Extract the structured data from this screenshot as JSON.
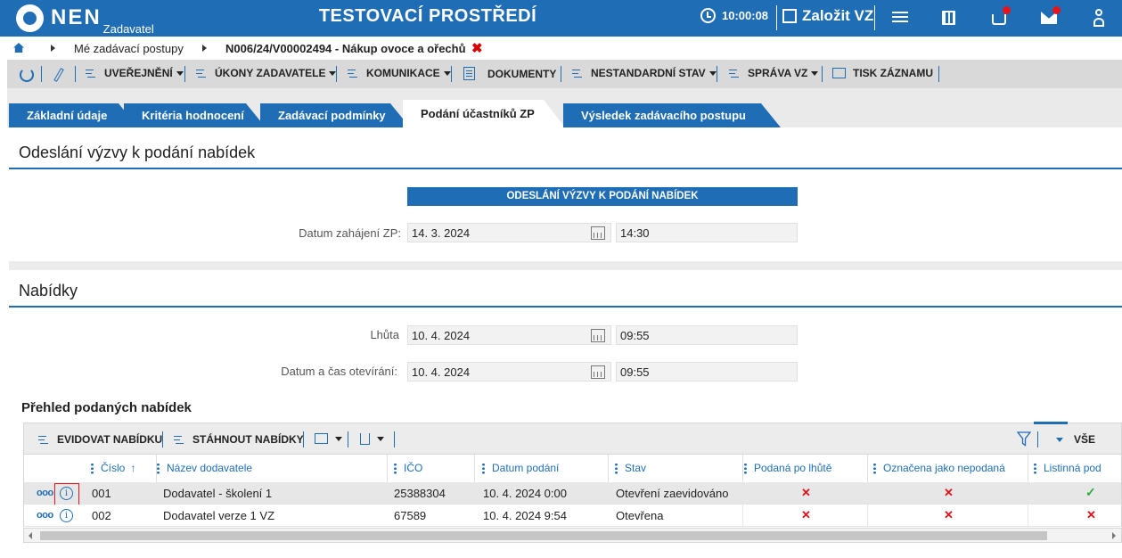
{
  "header": {
    "logo": "NEN",
    "logo_sub": "Zadavatel",
    "env_title": "TESTOVACÍ PROSTŘEDÍ",
    "clock": "10:00:08",
    "create_label": "Založit VZ",
    "icons": [
      "hamburger-menu-icon",
      "calculator-icon",
      "inbox-icon",
      "mail-icon",
      "user-icon"
    ]
  },
  "breadcrumb": {
    "items": [
      "Mé zadávací postupy",
      "N006/24/V00002494 - Nákup ovoce a ořechů"
    ],
    "close_glyph": "✖"
  },
  "toolbar": {
    "items": [
      {
        "label": "UVEŘEJNĚNÍ",
        "dropdown": true
      },
      {
        "label": "ÚKONY ZADAVATELE",
        "dropdown": true
      },
      {
        "label": "KOMUNIKACE",
        "dropdown": true
      },
      {
        "label": "DOKUMENTY",
        "dropdown": false
      },
      {
        "label": "NESTANDARDNÍ STAV",
        "dropdown": true
      },
      {
        "label": "SPRÁVA VZ",
        "dropdown": true
      },
      {
        "label": "TISK ZÁZNAMU",
        "dropdown": false
      }
    ]
  },
  "tabs": [
    {
      "label": "Základní údaje",
      "active": false
    },
    {
      "label": "Kritéria hodnocení",
      "active": false
    },
    {
      "label": "Zadávací podmínky",
      "active": false
    },
    {
      "label": "Podání účastníků ZP",
      "active": true
    },
    {
      "label": "Výsledek zadávacího postupu",
      "active": false
    }
  ],
  "section1": {
    "title": "Odeslání výzvy k podání nabídek",
    "header": "ODESLÁNÍ VÝZVY K PODÁNÍ NABÍDEK",
    "start_label": "Datum zahájení ZP:",
    "start_date": "14. 3. 2024",
    "start_time": "14:30"
  },
  "section2": {
    "title": "Nabídky",
    "deadline_label": "Lhůta",
    "deadline_date": "10. 4. 2024",
    "deadline_time": "09:55",
    "opening_label": "Datum a čas otevírání:",
    "opening_date": "10. 4. 2024",
    "opening_time": "09:55"
  },
  "offers": {
    "title": "Přehled podaných nabídek",
    "toolbar": {
      "register": "EVIDOVAT NABÍDKU",
      "download": "STÁHNOUT NABÍDKY",
      "filter_all": "VŠE"
    },
    "columns": [
      "Číslo",
      "Název dodavatele",
      "IČO",
      "Datum podání",
      "Stav",
      "Podaná po lhůtě",
      "Označena jako nepodaná",
      "Listinná pod"
    ],
    "sort_arrow": "↑",
    "rows": [
      {
        "number": "001",
        "supplier": "Dodavatel - školení 1",
        "ico": "25388304",
        "submitted": "10. 4. 2024 0:00",
        "status": "Otevření zaevidováno",
        "late": "✕",
        "not_submitted": "✕",
        "paper": "✓"
      },
      {
        "number": "002",
        "supplier": "Dodavatel verze 1 VZ",
        "ico": "67589",
        "submitted": "10. 4. 2024 9:54",
        "status": "Otevřena",
        "late": "✕",
        "not_submitted": "✕",
        "paper": "✕"
      }
    ]
  },
  "colors": {
    "brand_blue": "#1f6db5",
    "alert_red": "#e0121a",
    "ok_green": "#2fa83b"
  }
}
